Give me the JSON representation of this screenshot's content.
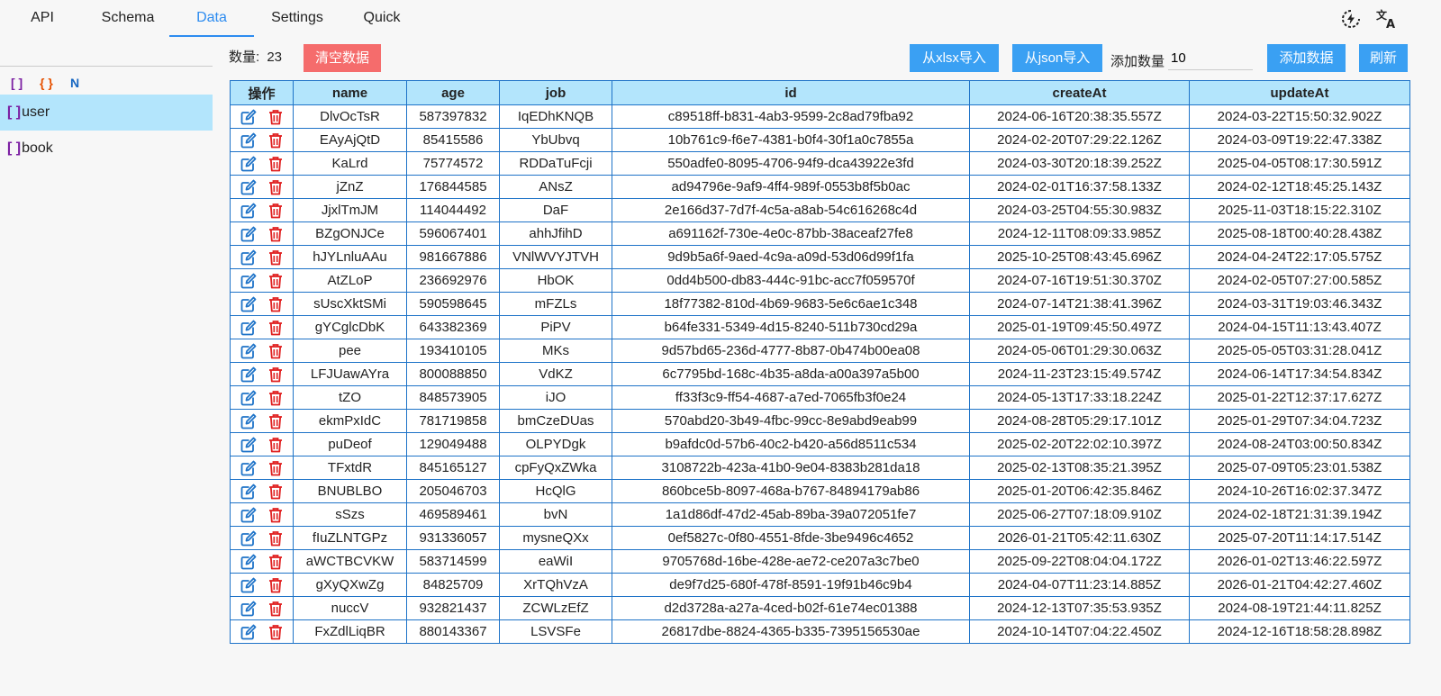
{
  "nav": {
    "tabs": [
      {
        "label": "API"
      },
      {
        "label": "Schema"
      },
      {
        "label": "Data"
      },
      {
        "label": "Settings"
      },
      {
        "label": "Quick"
      }
    ],
    "active_tab": "Data",
    "icons": [
      "power-flash-icon",
      "translate-icon"
    ]
  },
  "sidebar": {
    "search_value": "",
    "filters": [
      "[ ]",
      "{ }",
      "N"
    ],
    "filter_colors": [
      "#7b1fa2",
      "#e65100",
      "#1565c0"
    ],
    "items": [
      {
        "bracket": "[ ]",
        "label": "user",
        "active": true
      },
      {
        "bracket": "[ ]",
        "label": "book",
        "active": false
      }
    ]
  },
  "toolbar": {
    "count_label": "数量:",
    "count_value": "23",
    "clear_label": "清空数据",
    "import_xlsx_label": "从xlsx导入",
    "import_json_label": "从json导入",
    "add_count_label": "添加数量",
    "add_count_value": "10",
    "add_data_label": "添加数据",
    "refresh_label": "刷新"
  },
  "colors": {
    "accent": "#2d8cf0",
    "button_blue": "#3aa0f3",
    "button_red": "#f56c6c",
    "header_bg": "#b3e5fc",
    "border": "#1e73c8",
    "edit_icon": "#1e73c8",
    "delete_icon": "#e02020"
  },
  "table": {
    "columns": [
      "操作",
      "name",
      "age",
      "job",
      "id",
      "createAt",
      "updateAt"
    ],
    "rows": [
      [
        "DlvOcTsR",
        "587397832",
        "IqEDhKNQB",
        "c89518ff-b831-4ab3-9599-2c8ad79fba92",
        "2024-06-16T20:38:35.557Z",
        "2024-03-22T15:50:32.902Z"
      ],
      [
        "EAyAjQtD",
        "85415586",
        "YbUbvq",
        "10b761c9-f6e7-4381-b0f4-30f1a0c7855a",
        "2024-02-20T07:29:22.126Z",
        "2024-03-09T19:22:47.338Z"
      ],
      [
        "KaLrd",
        "75774572",
        "RDDaTuFcji",
        "550adfe0-8095-4706-94f9-dca43922e3fd",
        "2024-03-30T20:18:39.252Z",
        "2025-04-05T08:17:30.591Z"
      ],
      [
        "jZnZ",
        "176844585",
        "ANsZ",
        "ad94796e-9af9-4ff4-989f-0553b8f5b0ac",
        "2024-02-01T16:37:58.133Z",
        "2024-02-12T18:45:25.143Z"
      ],
      [
        "JjxlTmJM",
        "114044492",
        "DaF",
        "2e166d37-7d7f-4c5a-a8ab-54c616268c4d",
        "2024-03-25T04:55:30.983Z",
        "2025-11-03T18:15:22.310Z"
      ],
      [
        "BZgONJCe",
        "596067401",
        "ahhJfihD",
        "a691162f-730e-4e0c-87bb-38aceaf27fe8",
        "2024-12-11T08:09:33.985Z",
        "2025-08-18T00:40:28.438Z"
      ],
      [
        "hJYLnluAAu",
        "981667886",
        "VNlWVYJTVH",
        "9d9b5a6f-9aed-4c9a-a09d-53d06d99f1fa",
        "2025-10-25T08:43:45.696Z",
        "2024-04-24T22:17:05.575Z"
      ],
      [
        "AtZLoP",
        "236692976",
        "HbOK",
        "0dd4b500-db83-444c-91bc-acc7f059570f",
        "2024-07-16T19:51:30.370Z",
        "2024-02-05T07:27:00.585Z"
      ],
      [
        "sUscXktSMi",
        "590598645",
        "mFZLs",
        "18f77382-810d-4b69-9683-5e6c6ae1c348",
        "2024-07-14T21:38:41.396Z",
        "2024-03-31T19:03:46.343Z"
      ],
      [
        "gYCglcDbK",
        "643382369",
        "PiPV",
        "b64fe331-5349-4d15-8240-511b730cd29a",
        "2025-01-19T09:45:50.497Z",
        "2024-04-15T11:13:43.407Z"
      ],
      [
        "pee",
        "193410105",
        "MKs",
        "9d57bd65-236d-4777-8b87-0b474b00ea08",
        "2024-05-06T01:29:30.063Z",
        "2025-05-05T03:31:28.041Z"
      ],
      [
        "LFJUawAYra",
        "800088850",
        "VdKZ",
        "6c7795bd-168c-4b35-a8da-a00a397a5b00",
        "2024-11-23T23:15:49.574Z",
        "2024-06-14T17:34:54.834Z"
      ],
      [
        "tZO",
        "848573905",
        "iJO",
        "ff33f3c9-ff54-4687-a7ed-7065fb3f0e24",
        "2024-05-13T17:33:18.224Z",
        "2025-01-22T12:37:17.627Z"
      ],
      [
        "ekmPxIdC",
        "781719858",
        "bmCzeDUas",
        "570abd20-3b49-4fbc-99cc-8e9abd9eab99",
        "2024-08-28T05:29:17.101Z",
        "2025-01-29T07:34:04.723Z"
      ],
      [
        "puDeof",
        "129049488",
        "OLPYDgk",
        "b9afdc0d-57b6-40c2-b420-a56d8511c534",
        "2025-02-20T22:02:10.397Z",
        "2024-08-24T03:00:50.834Z"
      ],
      [
        "TFxtdR",
        "845165127",
        "cpFyQxZWka",
        "3108722b-423a-41b0-9e04-8383b281da18",
        "2025-02-13T08:35:21.395Z",
        "2025-07-09T05:23:01.538Z"
      ],
      [
        "BNUBLBO",
        "205046703",
        "HcQlG",
        "860bce5b-8097-468a-b767-84894179ab86",
        "2025-01-20T06:42:35.846Z",
        "2024-10-26T16:02:37.347Z"
      ],
      [
        "sSzs",
        "469589461",
        "bvN",
        "1a1d86df-47d2-45ab-89ba-39a072051fe7",
        "2025-06-27T07:18:09.910Z",
        "2024-02-18T21:31:39.194Z"
      ],
      [
        "fIuZLNTGPz",
        "931336057",
        "mysneQXx",
        "0ef5827c-0f80-4551-8fde-3be9496c4652",
        "2026-01-21T05:42:11.630Z",
        "2025-07-20T11:14:17.514Z"
      ],
      [
        "aWCTBCVKW",
        "583714599",
        "eaWiI",
        "9705768d-16be-428e-ae72-ce207a3c7be0",
        "2025-09-22T08:04:04.172Z",
        "2026-01-02T13:46:22.597Z"
      ],
      [
        "gXyQXwZg",
        "84825709",
        "XrTQhVzA",
        "de9f7d25-680f-478f-8591-19f91b46c9b4",
        "2024-04-07T11:23:14.885Z",
        "2026-01-21T04:42:27.460Z"
      ],
      [
        "nuccV",
        "932821437",
        "ZCWLzEfZ",
        "d2d3728a-a27a-4ced-b02f-61e74ec01388",
        "2024-12-13T07:35:53.935Z",
        "2024-08-19T21:44:11.825Z"
      ],
      [
        "FxZdlLiqBR",
        "880143367",
        "LSVSFe",
        "26817dbe-8824-4365-b335-7395156530ae",
        "2024-10-14T07:04:22.450Z",
        "2024-12-16T18:58:28.898Z"
      ]
    ]
  }
}
